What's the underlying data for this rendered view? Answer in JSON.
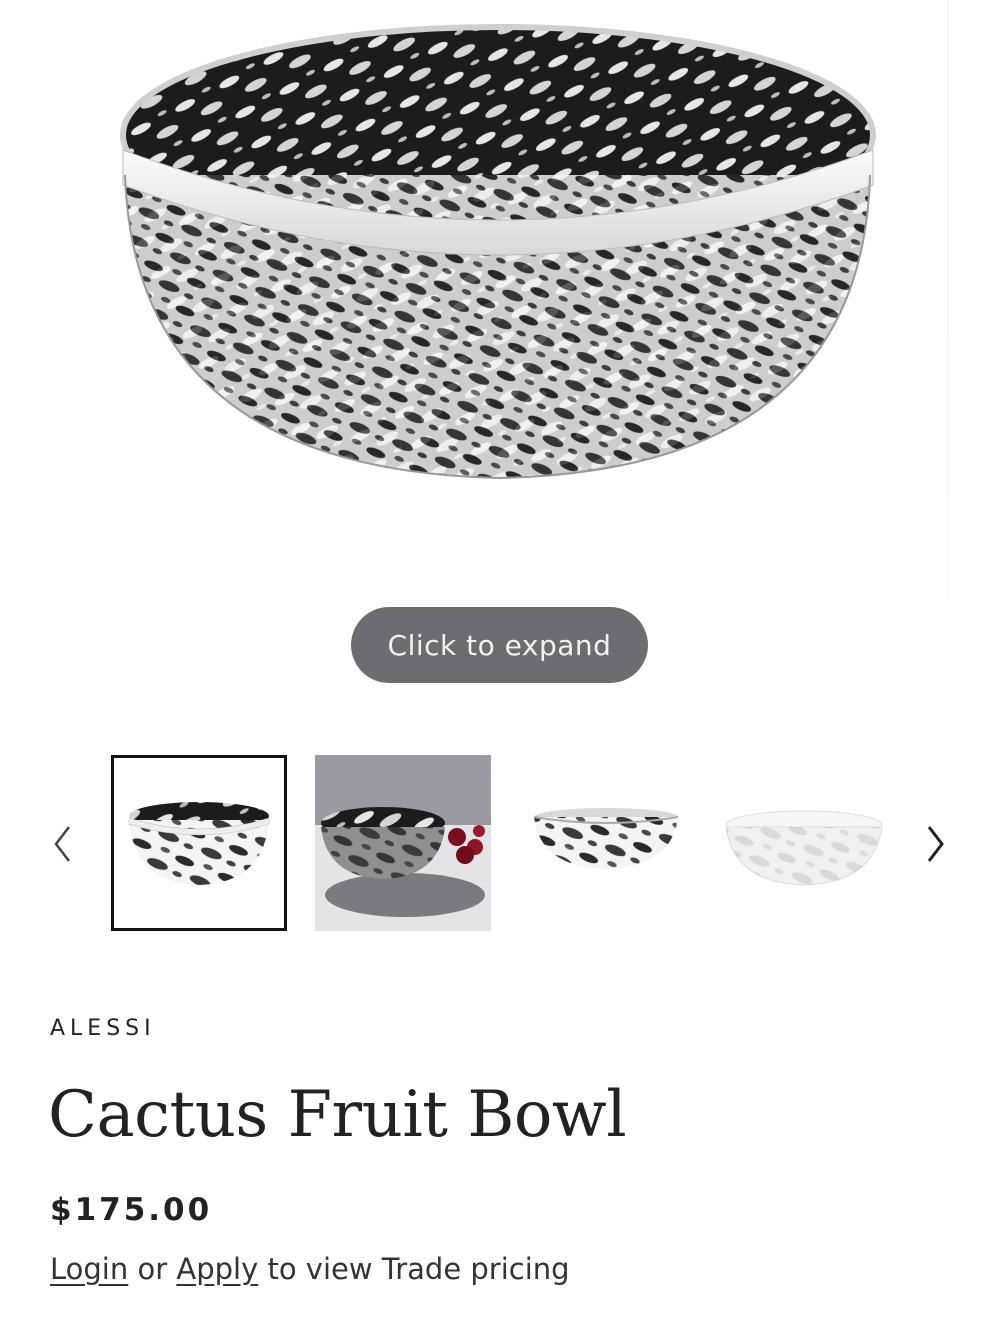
{
  "gallery": {
    "expand_label": "Click to expand",
    "prev_label": "Previous image",
    "next_label": "Next image",
    "thumbnail_count": 4,
    "active_thumbnail_index": 0
  },
  "product": {
    "brand": "ALESSI",
    "title": "Cactus Fruit Bowl",
    "price": "$175.00"
  },
  "trade": {
    "login_label": "Login",
    "or_text": "or",
    "apply_label": "Apply",
    "suffix_text": "to view Trade pricing"
  },
  "colors": {
    "expand_button_bg": "#6c6c73",
    "text": "#222222"
  }
}
